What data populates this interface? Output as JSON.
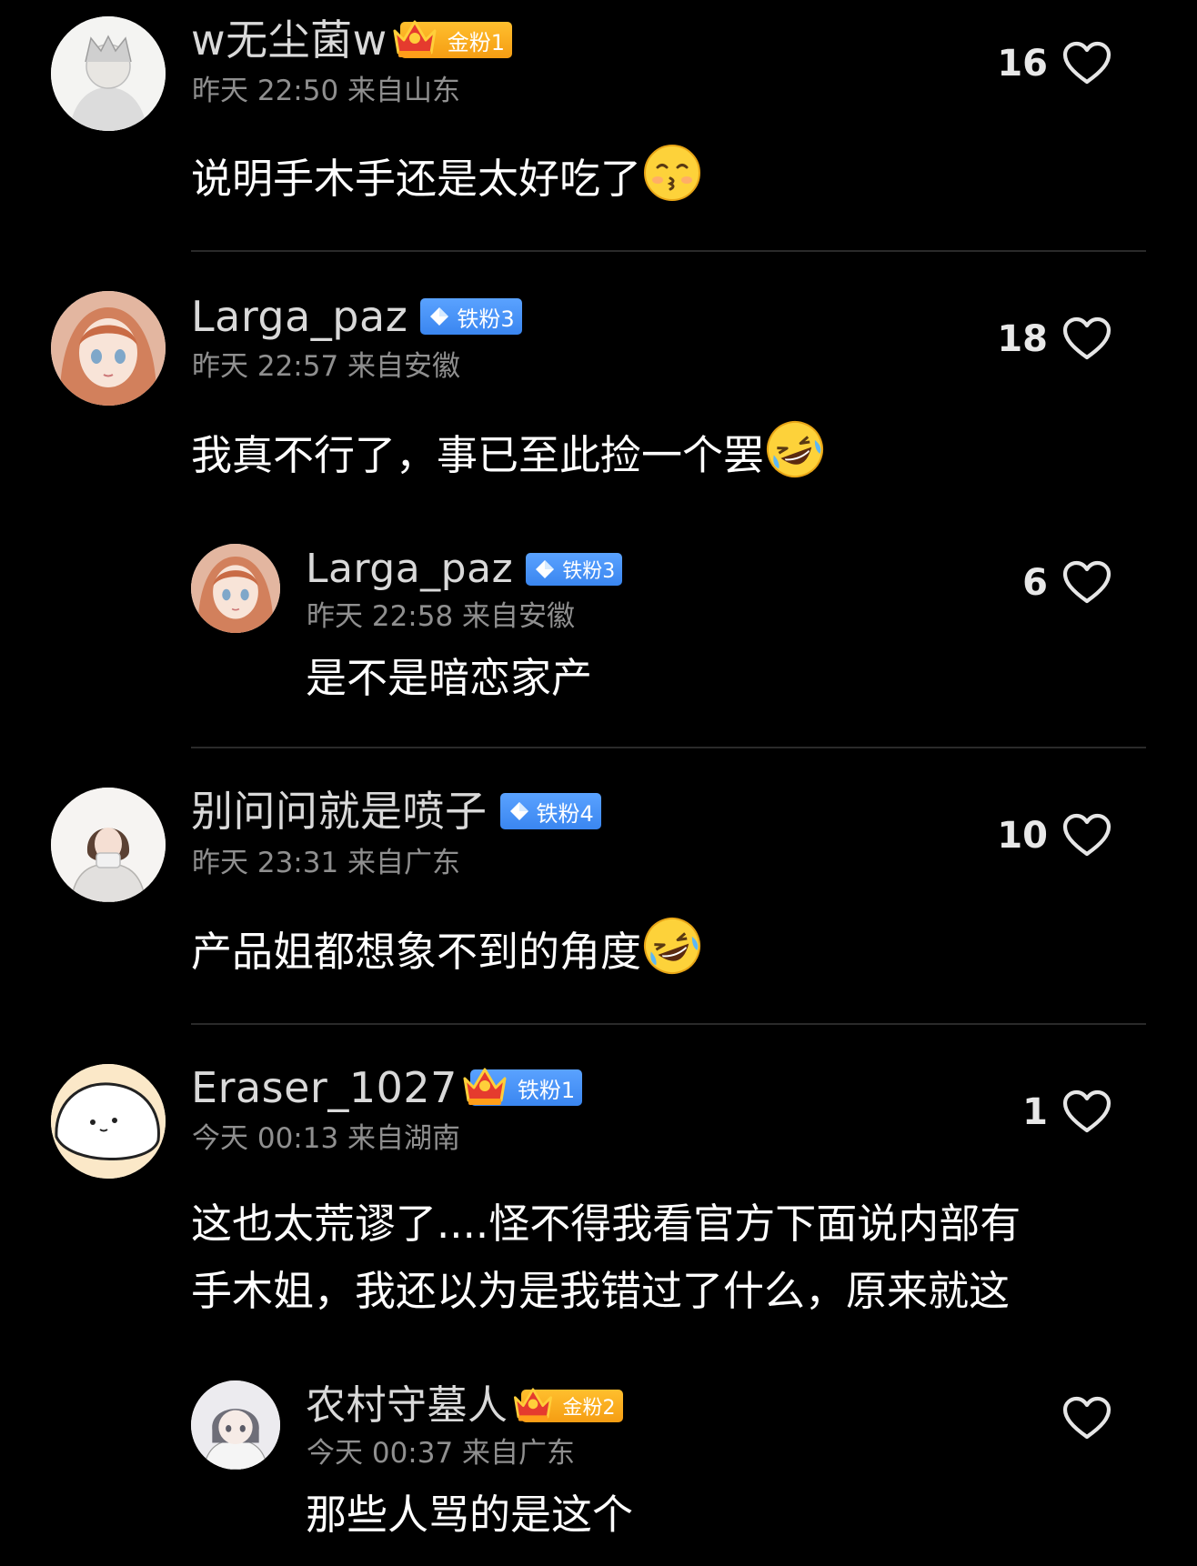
{
  "comments": [
    {
      "username": "w无尘菌w",
      "badge": "金粉1",
      "meta": "昨天 22:50 来自山东",
      "text": "说明手木手还是太好吃了",
      "likes": "16",
      "emoji": "kissing-face-emoji"
    },
    {
      "username": "Larga_paz",
      "badge": "铁粉3",
      "meta": "昨天 22:57 来自安徽",
      "text": "我真不行了，事已至此捡一个罢",
      "likes": "18",
      "emoji": "rolling-laughing-emoji",
      "reply": {
        "username": "Larga_paz",
        "badge": "铁粉3",
        "meta": "昨天 22:58 来自安徽",
        "text": "是不是暗恋家产",
        "likes": "6"
      }
    },
    {
      "username": "别问问就是喷子",
      "badge": "铁粉4",
      "meta": "昨天 23:31 来自广东",
      "text": "产品姐都想象不到的角度",
      "likes": "10",
      "emoji": "rolling-laughing-emoji"
    },
    {
      "username": "Eraser_1027",
      "badge": "铁粉1",
      "meta": "今天 00:13 来自湖南",
      "text_lines": [
        "这也太荒谬了....怪不得我看官方下面说内部有",
        "手木姐，我还以为是我错过了什么，原来就这"
      ],
      "likes": "1",
      "reply": {
        "username": "农村守墓人",
        "badge": "金粉2",
        "meta": "今天 00:37 来自广东",
        "text": "那些人骂的是这个",
        "likes": ""
      }
    }
  ],
  "colors": {
    "background": "#000000",
    "gold_badge": "#f8ab1c",
    "iron_badge": "#4a94f8",
    "meta_text": "#8f8f8f",
    "divider": "#2a2a2a"
  },
  "icons": [
    "heart-outline-icon",
    "diamond-icon",
    "crown-icon"
  ]
}
